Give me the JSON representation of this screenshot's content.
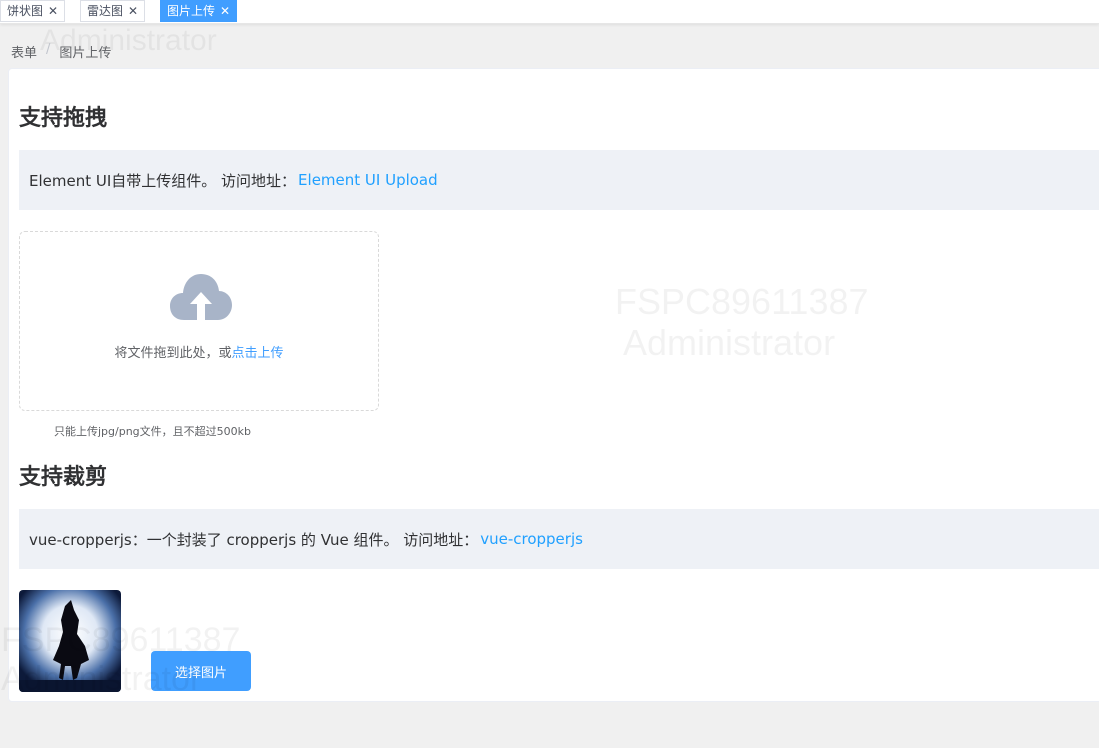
{
  "tabs": [
    {
      "label": "饼状图",
      "active": false
    },
    {
      "label": "雷达图",
      "active": false
    },
    {
      "label": "图片上传",
      "active": true
    }
  ],
  "tab_close_glyph": "✕",
  "breadcrumb": {
    "items": [
      "表单",
      "图片上传"
    ],
    "separator": "/"
  },
  "section_drag": {
    "title": "支持拖拽",
    "tip_text": "Element UI自带上传组件。 访问地址：",
    "tip_link": "Element UI Upload",
    "drop_text": "将文件拖到此处，或",
    "drop_link": "点击上传",
    "upload_tip": "只能上传jpg/png文件，且不超过500kb",
    "icon": "cloud-upload-icon"
  },
  "section_crop": {
    "title": "支持裁剪",
    "tip_text": "vue-cropperjs：一个封装了 cropperjs 的 Vue 组件。 访问地址：",
    "tip_link": "vue-cropperjs",
    "select_button": "选择图片"
  },
  "watermark": {
    "line1": "FSPC89611387",
    "line2": "Administrator"
  },
  "colors": {
    "accent": "#409eff",
    "link": "#20a0ff",
    "tip_bg": "#eef1f6",
    "icon_gray": "#a8b4c8"
  }
}
